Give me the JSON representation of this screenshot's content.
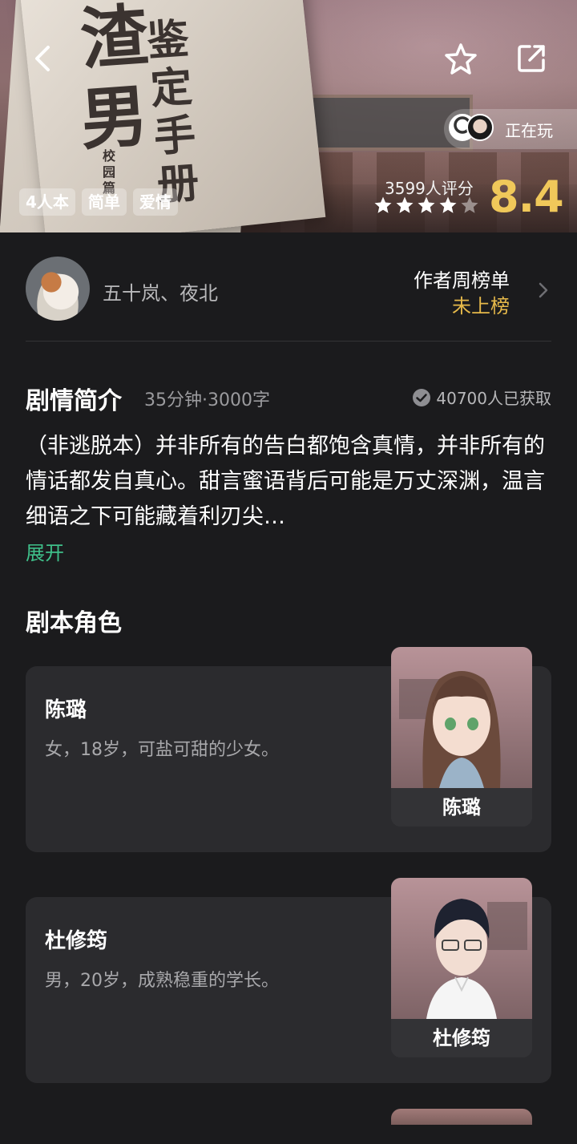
{
  "hero": {
    "title_chars": [
      "渣",
      "男",
      "鉴定手册"
    ],
    "subtitle": "校园篇",
    "playing_label": "正在玩",
    "tags": [
      "4人本",
      "简单",
      "爱情"
    ],
    "rating_count": "3599人评分",
    "score": "8.4",
    "stars": 4,
    "star_color": "#ffffff",
    "score_color": "#f0c85a"
  },
  "author": {
    "names": "五十岚、夜北",
    "rank_title": "作者周榜单",
    "rank_value": "未上榜"
  },
  "synopsis": {
    "title": "剧情简介",
    "meta": "35分钟·3000字",
    "obtained": "40700人已获取",
    "body": "（非逃脱本）并非所有的告白都饱含真情，并非所有的情话都发自真心。甜言蜜语背后可能是万丈深渊，温言细语之下可能藏着利刃尖…",
    "expand_label": "展开",
    "expand_color": "#3fc08a"
  },
  "roles": {
    "title": "剧本角色",
    "items": [
      {
        "name": "陈璐",
        "desc": "女，18岁，可盐可甜的少女。",
        "portrait_label": "陈璐"
      },
      {
        "name": "杜修筠",
        "desc": "男，20岁，成熟稳重的学长。",
        "portrait_label": "杜修筠"
      }
    ]
  }
}
